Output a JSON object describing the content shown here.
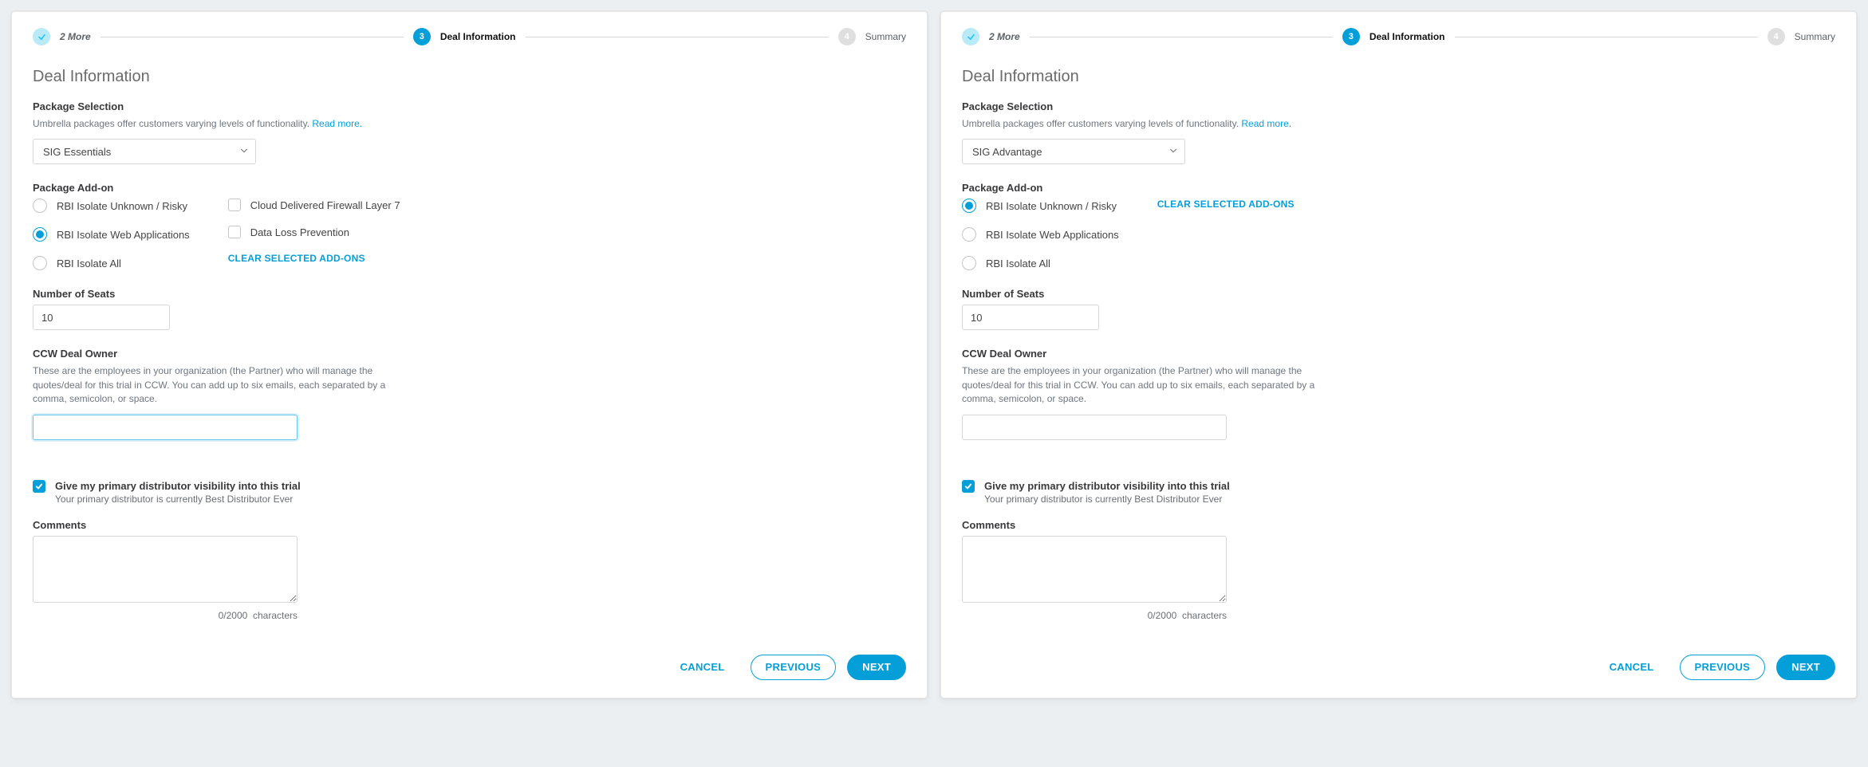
{
  "left": {
    "stepper": {
      "more_label": "2 More",
      "current_step_num": "3",
      "current_step_label": "Deal Information",
      "summary_step_num": "4",
      "summary_label": "Summary"
    },
    "title": "Deal Information",
    "package_section_label": "Package Selection",
    "package_help": "Umbrella packages offer customers varying levels of functionality. ",
    "read_more": "Read more.",
    "package_value": "SIG Essentials",
    "addon_section_label": "Package Add-on",
    "addons": {
      "radio1": "RBI Isolate Unknown / Risky",
      "radio2": "RBI Isolate Web Applications",
      "radio3": "RBI Isolate All",
      "chk1": "Cloud Delivered Firewall Layer 7",
      "chk2": "Data Loss Prevention",
      "clear": "CLEAR SELECTED ADD-ONS",
      "selected_radio": "radio2"
    },
    "seats_label": "Number of Seats",
    "seats_value": "10",
    "ccw_label": "CCW Deal Owner",
    "ccw_help": "These are the employees in your organization (the Partner) who will manage the quotes/deal for this trial in CCW. You can add up to six emails, each separated by a comma, semicolon, or space.",
    "ccw_value": "",
    "visibility_title": "Give my primary distributor visibility into this trial",
    "visibility_sub": "Your primary distributor is currently Best Distributor Ever",
    "comments_label": "Comments",
    "char_counter": "0/2000",
    "char_word": "characters",
    "footer": {
      "cancel": "CANCEL",
      "prev": "PREVIOUS",
      "next": "NEXT"
    }
  },
  "right": {
    "stepper": {
      "more_label": "2 More",
      "current_step_num": "3",
      "current_step_label": "Deal Information",
      "summary_step_num": "4",
      "summary_label": "Summary"
    },
    "title": "Deal Information",
    "package_section_label": "Package Selection",
    "package_help": "Umbrella packages offer customers varying levels of functionality. ",
    "read_more": "Read more.",
    "package_value": "SIG Advantage",
    "addon_section_label": "Package Add-on",
    "addons": {
      "radio1": "RBI Isolate Unknown / Risky",
      "radio2": "RBI Isolate Web Applications",
      "radio3": "RBI Isolate All",
      "clear": "CLEAR SELECTED ADD-ONS",
      "selected_radio": "radio1"
    },
    "seats_label": "Number of Seats",
    "seats_value": "10",
    "ccw_label": "CCW Deal Owner",
    "ccw_help": "These are the employees in your organization (the Partner) who will manage the quotes/deal for this trial in CCW. You can add up to six emails, each separated by a comma, semicolon, or space.",
    "ccw_value": "",
    "visibility_title": "Give my primary distributor visibility into this trial",
    "visibility_sub": "Your primary distributor is currently Best Distributor Ever",
    "comments_label": "Comments",
    "char_counter": "0/2000",
    "char_word": "characters",
    "footer": {
      "cancel": "CANCEL",
      "prev": "PREVIOUS",
      "next": "NEXT"
    }
  }
}
